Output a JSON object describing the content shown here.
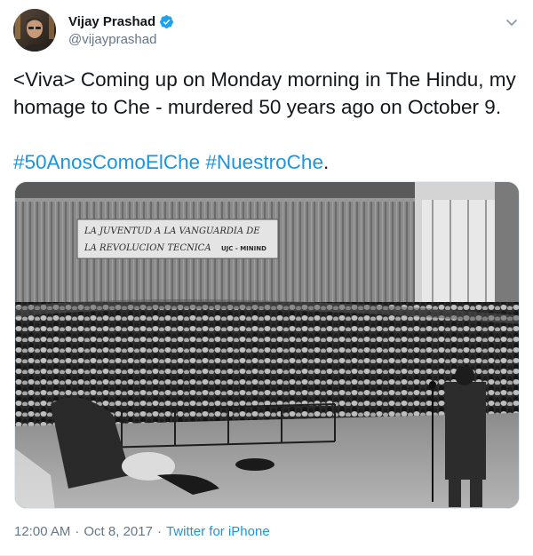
{
  "tweet": {
    "author": {
      "display_name": "Vijay Prashad",
      "handle": "@vijayprashad",
      "verified_icon": "verified-badge-icon"
    },
    "menu_icon": "chevron-down-icon",
    "text_line1": "<Viva> Coming up on Monday morning in The Hindu, my",
    "text_line2": "homage to Che - murdered 50 years ago on October 9.",
    "hashtag1": "#50AnosComoElChe",
    "hashtag2": "#NuestroChe",
    "trailing_punct": ".",
    "media": {
      "banner_line1": "LA JUVENTUD A LA VANGUARDIA DE",
      "banner_line2": "LA REVOLUCION TECNICA",
      "banner_tag": "UJC - MININD"
    },
    "time": "12:00 AM",
    "separator": "·",
    "date": "Oct 8, 2017",
    "source": "Twitter for iPhone"
  },
  "colors": {
    "link": "#1b95e0",
    "secondary": "#657786",
    "primary_text": "#14171a",
    "verified": "#1da1f2"
  }
}
